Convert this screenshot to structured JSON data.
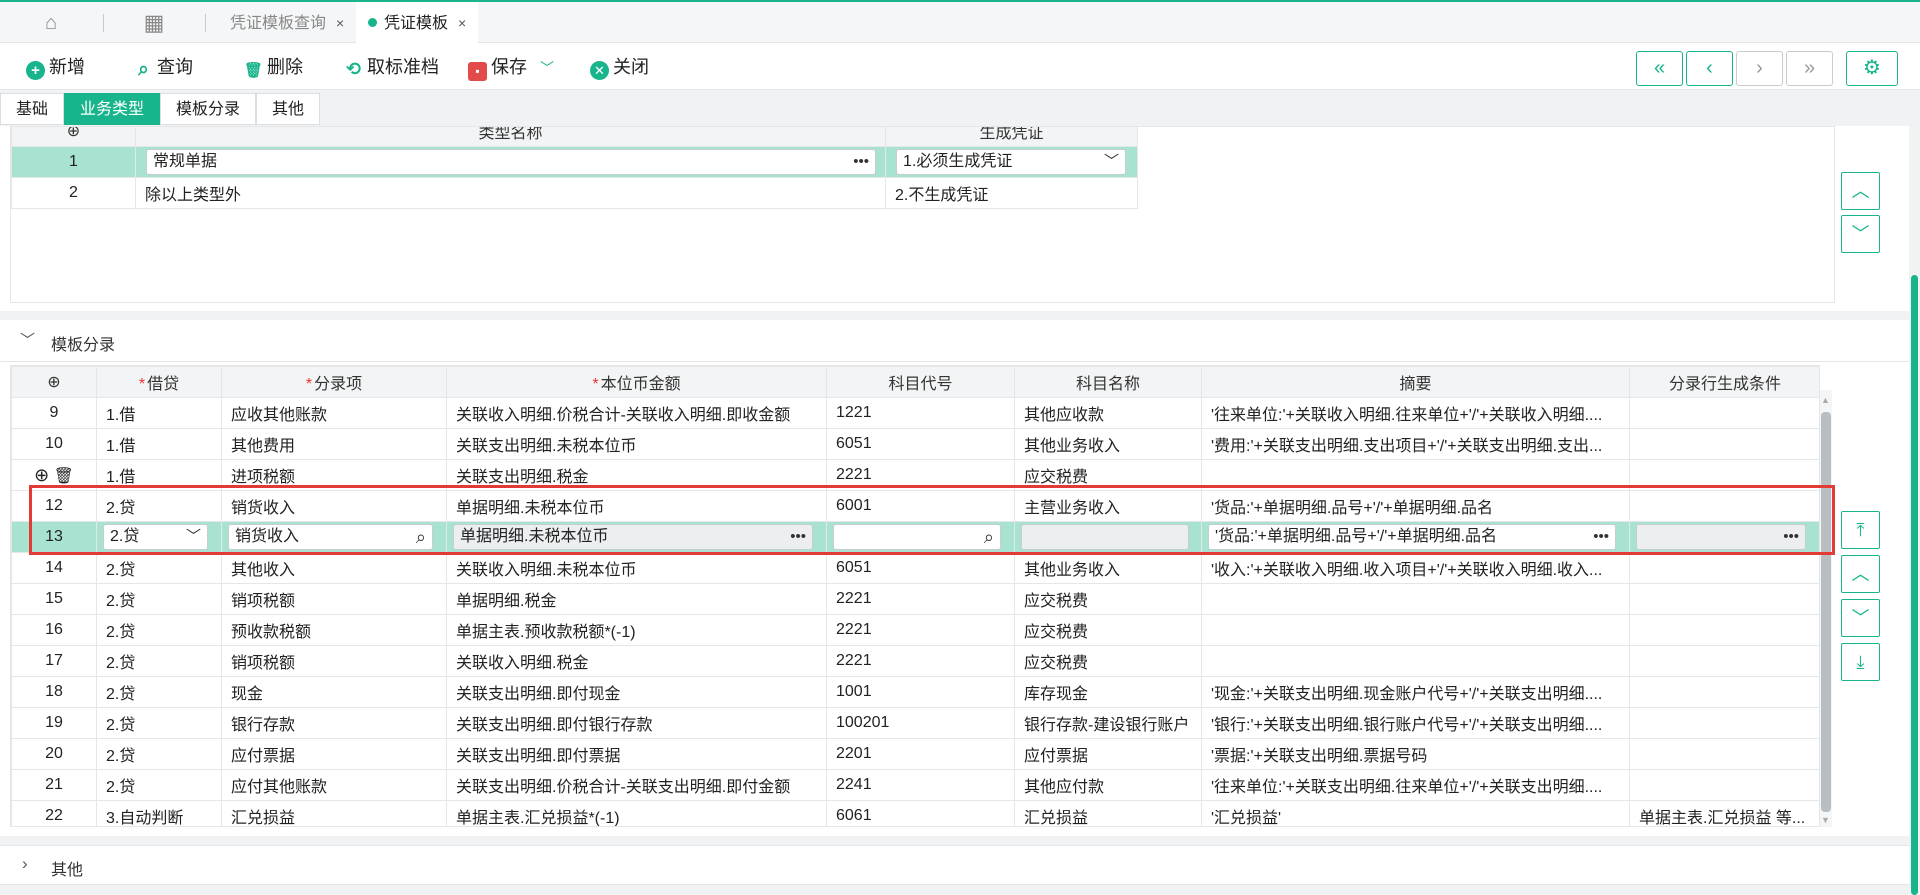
{
  "topbar": {
    "home_icon": "home-icon",
    "apps_icon": "grid-icon",
    "tabs": [
      {
        "label": "凭证模板查询"
      },
      {
        "label": "凭证模板"
      }
    ],
    "close_glyph": "×"
  },
  "toolbar": {
    "add": "新增",
    "query": "查询",
    "delete": "删除",
    "unstandard": "取标准档",
    "save": "保存",
    "close": "关闭"
  },
  "subtabs": [
    "基础",
    "业务类型",
    "模板分录",
    "其他"
  ],
  "business_types": {
    "headers": [
      "类型名称",
      "生成凭证"
    ],
    "rows": [
      {
        "num": "1",
        "name": "常规单据",
        "gen": "1.必须生成凭证"
      },
      {
        "num": "2",
        "name": "除以上类型外",
        "gen": "2.不生成凭证"
      }
    ]
  },
  "entries_section": {
    "title": "模板分录",
    "headers": [
      "借贷",
      "分录项",
      "本位币金额",
      "科目代号",
      "科目名称",
      "摘要",
      "分录行生成条件"
    ],
    "rows": [
      {
        "num": "9",
        "dc": "1.借",
        "item": "应收其他账款",
        "amount": "关联收入明细.价税合计-关联收入明细.即收金额",
        "code": "1221",
        "subject": "其他应收款",
        "summary": "'往来单位:'+关联收入明细.往来单位+'/'+关联收入明细....",
        "cond": ""
      },
      {
        "num": "10",
        "dc": "1.借",
        "item": "其他费用",
        "amount": "关联支出明细.未税本位币",
        "code": "6051",
        "subject": "其他业务收入",
        "summary": "'费用:'+关联支出明细.支出项目+'/'+关联支出明细.支出...",
        "cond": ""
      },
      {
        "num": "",
        "dc": "1.借",
        "item": "进项税额",
        "amount": "关联支出明细.税金",
        "code": "2221",
        "subject": "应交税费",
        "summary": "",
        "cond": ""
      },
      {
        "num": "12",
        "dc": "2.贷",
        "item": "销货收入",
        "amount": "单据明细.未税本位币",
        "code": "6001",
        "subject": "主营业务收入",
        "summary": "'货品:'+单据明细.品号+'/'+单据明细.品名",
        "cond": ""
      },
      {
        "num": "13",
        "dc": "2.贷",
        "item": "销货收入",
        "amount": "单据明细.未税本位币",
        "code": "",
        "subject": "",
        "summary": "'货品:'+单据明细.品号+'/'+单据明细.品名",
        "cond": ""
      },
      {
        "num": "14",
        "dc": "2.贷",
        "item": "其他收入",
        "amount": "关联收入明细.未税本位币",
        "code": "6051",
        "subject": "其他业务收入",
        "summary": "'收入:'+关联收入明细.收入项目+'/'+关联收入明细.收入...",
        "cond": ""
      },
      {
        "num": "15",
        "dc": "2.贷",
        "item": "销项税额",
        "amount": "单据明细.税金",
        "code": "2221",
        "subject": "应交税费",
        "summary": "",
        "cond": ""
      },
      {
        "num": "16",
        "dc": "2.贷",
        "item": "预收款税额",
        "amount": "单据主表.预收款税额*(-1)",
        "code": "2221",
        "subject": "应交税费",
        "summary": "",
        "cond": ""
      },
      {
        "num": "17",
        "dc": "2.贷",
        "item": "销项税额",
        "amount": "关联收入明细.税金",
        "code": "2221",
        "subject": "应交税费",
        "summary": "",
        "cond": ""
      },
      {
        "num": "18",
        "dc": "2.贷",
        "item": "现金",
        "amount": "关联支出明细.即付现金",
        "code": "1001",
        "subject": "库存现金",
        "summary": "'现金:'+关联支出明细.现金账户代号+'/'+关联支出明细....",
        "cond": ""
      },
      {
        "num": "19",
        "dc": "2.贷",
        "item": "银行存款",
        "amount": "关联支出明细.即付银行存款",
        "code": "100201",
        "subject": "银行存款-建设银行账户",
        "summary": "'银行:'+关联支出明细.银行账户代号+'/'+关联支出明细....",
        "cond": ""
      },
      {
        "num": "20",
        "dc": "2.贷",
        "item": "应付票据",
        "amount": "关联支出明细.即付票据",
        "code": "2201",
        "subject": "应付票据",
        "summary": "'票据:'+关联支出明细.票据号码",
        "cond": ""
      },
      {
        "num": "21",
        "dc": "2.贷",
        "item": "应付其他账款",
        "amount": "关联支出明细.价税合计-关联支出明细.即付金额",
        "code": "2241",
        "subject": "其他应付款",
        "summary": "'往来单位:'+关联支出明细.往来单位+'/'+关联支出明细....",
        "cond": ""
      },
      {
        "num": "22",
        "dc": "3.自动判断",
        "item": "汇兑损益",
        "amount": "单据主表.汇兑损益*(-1)",
        "code": "6061",
        "subject": "汇兑损益",
        "summary": "'汇兑损益'",
        "cond": "单据主表.汇兑损益 等..."
      }
    ]
  },
  "other_section": {
    "title": "其他"
  },
  "colors": {
    "accent": "#18b48b",
    "highlight_border": "#e53935",
    "selected_row": "#a8e3d2"
  }
}
